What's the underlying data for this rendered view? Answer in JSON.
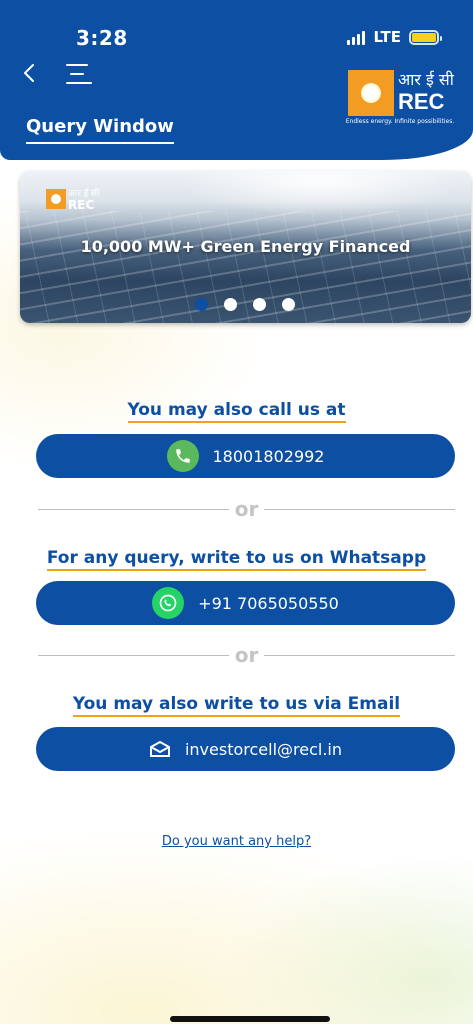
{
  "status_bar": {
    "time": "3:28",
    "network": "LTE"
  },
  "header": {
    "title": "Query Window",
    "logo": {
      "hindi": "आर ई सी",
      "rec": "REC",
      "tagline": "Endless energy. Infinite possibilities."
    }
  },
  "banner": {
    "title": "10,000 MW+ Green Energy Financed",
    "logo": {
      "hindi": "आर ई सी",
      "rec": "REC"
    },
    "slides_total": 4,
    "active_slide": 1
  },
  "call": {
    "heading": "You may also call us at",
    "value": "18001802992"
  },
  "divider_text": "or",
  "whatsapp": {
    "heading": "For any query, write to us on Whatsapp",
    "value": "+91 7065050550"
  },
  "email": {
    "heading": "You may also write to us via Email",
    "value": "investorcell@recl.in"
  },
  "help_link": "Do you want any help?",
  "icons": {
    "back": "chevron-left-icon",
    "menu": "menu-icon",
    "phone": "phone-icon",
    "whatsapp": "whatsapp-icon",
    "email": "envelope-icon"
  },
  "colors": {
    "primary": "#0d4fa2",
    "accent": "#f0a21e",
    "phone_green": "#5cb85c",
    "whatsapp_green": "#25d366"
  }
}
